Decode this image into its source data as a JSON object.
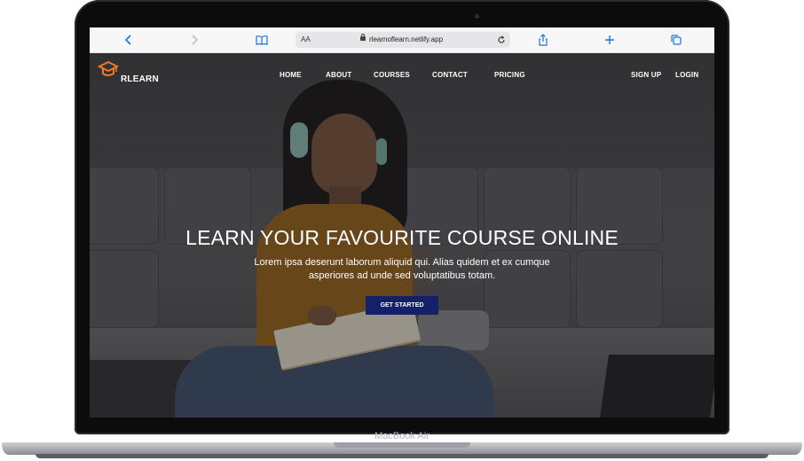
{
  "browser": {
    "reader_label": "AA",
    "url": "rlearnoflearn.netlify.app"
  },
  "site": {
    "brand": "RLEARN",
    "nav": {
      "home": "HOME",
      "about": "ABOUT",
      "courses": "COURSES",
      "contact": "CONTACT",
      "pricing": "PRICING",
      "sign_up": "SIGN UP",
      "login": "LOGIN"
    },
    "hero": {
      "title": "LEARN YOUR FAVOURITE COURSE ONLINE",
      "subtitle": "Lorem ipsa deserunt laborum aliquid qui. Alias quidem et ex cumque asperiores ad unde sed voluptatibus totam.",
      "cta": "GET STARTED"
    }
  },
  "device": {
    "model": "MacBook Air"
  },
  "colors": {
    "accent_logo": "#f0782c",
    "cta_background": "#14206a",
    "browser_icon": "#1a73e8"
  },
  "icons": [
    "back-icon",
    "forward-icon",
    "book-icon",
    "lock-icon",
    "reload-icon",
    "share-icon",
    "new-tab-icon",
    "tabs-icon",
    "graduation-cap-icon"
  ]
}
